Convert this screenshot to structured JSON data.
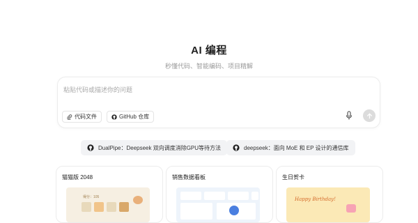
{
  "header": {
    "title": "AI 编程",
    "subtitle": "秒懂代码、智能编码、项目精解"
  },
  "prompt": {
    "placeholder": "粘贴代码或描述你的问题",
    "code_file_label": "代码文件",
    "github_label": "GitHub 仓库"
  },
  "suggestions": [
    {
      "label": "DualPipe：Deepseek 双向调度消除GPU等待方法",
      "icon": "github-icon"
    },
    {
      "label": "deepseek：面向 MoE 和 EP 设计的通信库",
      "icon": "github-icon"
    }
  ],
  "cards": [
    {
      "title": "猫猫版 2048",
      "thumb_text": "得分：105"
    },
    {
      "title": "销售数据看板"
    },
    {
      "title": "生日贺卡",
      "thumb_text": "Happy Birthday!"
    }
  ],
  "colors": {
    "accent": "#1f1f1f",
    "send_disabled": "#dcdcdc",
    "chip_bg": "#f2f3f5"
  }
}
